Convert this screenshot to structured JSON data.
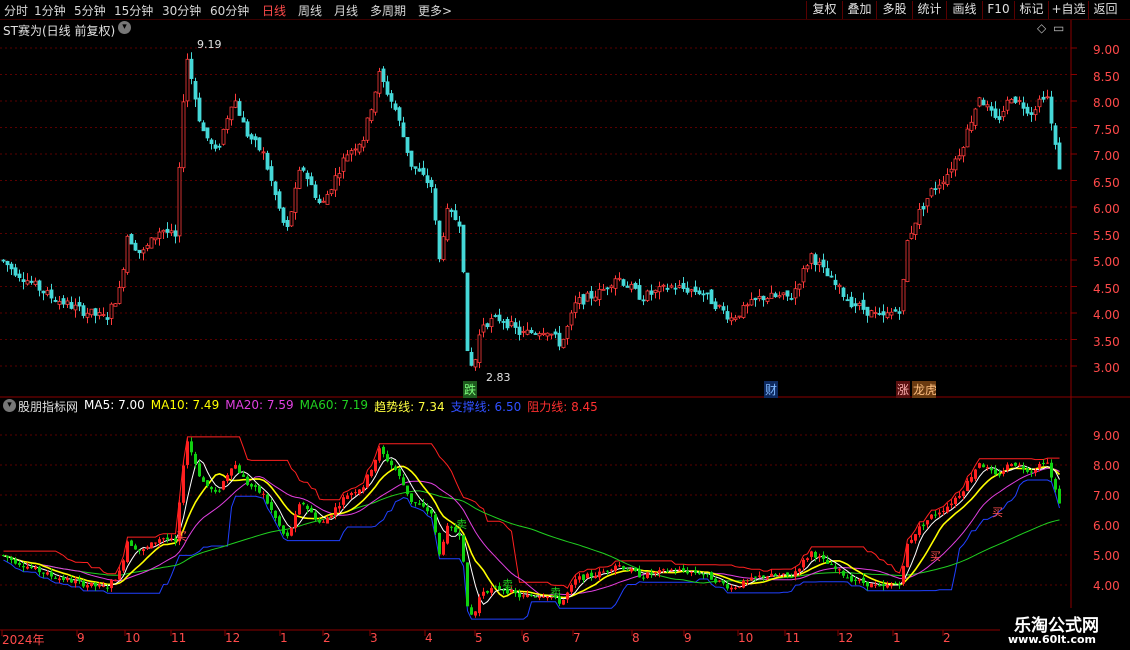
{
  "toolbar": {
    "periods": [
      "分时",
      "1分钟",
      "5分钟",
      "15分钟",
      "30分钟",
      "60分钟",
      "日线",
      "周线",
      "月线",
      "多周期",
      "更多"
    ],
    "active_period": "日线",
    "more_arrow": ">",
    "buttons": [
      "复权",
      "叠加",
      "多股",
      "统计",
      "画线",
      "F10",
      "标记",
      "+自选",
      "返回"
    ]
  },
  "main_chart": {
    "title": "ST赛为(日线 前复权)",
    "price_axis": [
      "9.00",
      "8.50",
      "8.00",
      "7.50",
      "7.00",
      "6.50",
      "6.00",
      "5.50",
      "5.00",
      "4.50",
      "4.00",
      "3.50",
      "3.00"
    ],
    "high_label": "9.19",
    "low_label": "2.83",
    "markers": [
      {
        "text": "跌",
        "color": "#3cc84a"
      },
      {
        "text": "财",
        "color": "#4aa0ff"
      },
      {
        "text": "涨",
        "color": "#ff5a5a"
      },
      {
        "text": "龙虎榜",
        "color": "#ff8a2a"
      }
    ]
  },
  "indicator": {
    "name": "股朋指标网",
    "values": [
      {
        "label": "MA5: 7.00",
        "color": "#ffffff"
      },
      {
        "label": "MA10: 7.49",
        "color": "#ffff00"
      },
      {
        "label": "MA20: 7.59",
        "color": "#e040e0"
      },
      {
        "label": "MA60: 7.19",
        "color": "#20d020"
      },
      {
        "label": "趋势线: 7.34",
        "color": "#ffff40"
      },
      {
        "label": "支撑线: 6.50",
        "color": "#3050ff"
      },
      {
        "label": "阻力线: 8.45",
        "color": "#ff3030"
      }
    ],
    "price_axis": [
      "9.00",
      "8.00",
      "7.00",
      "6.00",
      "5.00",
      "4.00"
    ],
    "signals": [
      {
        "text": "买",
        "color": "#ff5050"
      },
      {
        "text": "卖",
        "color": "#20d020"
      },
      {
        "text": "卖",
        "color": "#20d020"
      },
      {
        "text": "卖",
        "color": "#20d020"
      },
      {
        "text": "买",
        "color": "#ff5050"
      },
      {
        "text": "买",
        "color": "#ff5050"
      }
    ]
  },
  "time_axis": [
    "2024年",
    "9",
    "10",
    "11",
    "12",
    "1",
    "2",
    "3",
    "4",
    "5",
    "6",
    "7",
    "8",
    "9",
    "10",
    "11",
    "12",
    "1",
    "2"
  ],
  "watermark": {
    "title": "乐淘公式网",
    "url": "www.60lt.com"
  },
  "colors": {
    "up": "#ff3b3b",
    "down": "#45d8d8",
    "grid": "#5a0000"
  }
}
